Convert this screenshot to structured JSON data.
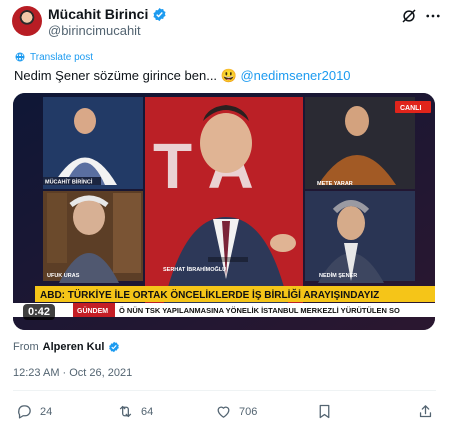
{
  "author": {
    "display_name": "Mücahit Birinci",
    "handle": "@birincimucahit"
  },
  "translate_label": "Translate post",
  "tweet": {
    "text": "Nedim Şener sözüme girince ben...",
    "emoji": "😃",
    "mention": "@nedimsener2010"
  },
  "video": {
    "duration": "0:42",
    "ticker_headline": "ABD: TÜRKİYE İLE ORTAK ÖNCELİKLERDE İŞ BİRLİĞİ ARAYIŞINDAYIZ",
    "ticker_section": "GÜNDEM",
    "ticker_text": "Ö NÜN TSK YAPILANMASINA YÖNELİK İSTANBUL MERKEZLİ YÜRÜTÜLEN SO",
    "live_badge": "CANLI",
    "channel_letters": "T  A",
    "panel_names": [
      "MÜCAHİT BİRİNCİ",
      "METE YARAR",
      "UFUK URAS",
      "SERHAT İBRAHİMOĞLU",
      "NEDİM ŞENER"
    ]
  },
  "attribution": {
    "prefix": "From",
    "source": "Alperen Kul"
  },
  "timestamp": "12:23 AM · Oct 26, 2021",
  "actions": {
    "replies": "24",
    "reposts": "64",
    "likes": "706"
  },
  "colors": {
    "accent": "#1d9bf0",
    "text": "#0f1419",
    "muted": "#536471",
    "live_red": "#e0241b",
    "ticker_yellow": "#f5c518"
  },
  "icons": [
    "grok-icon",
    "more-icon",
    "verified-icon",
    "translate-icon",
    "reply-icon",
    "repost-icon",
    "like-icon",
    "bookmark-icon",
    "share-icon"
  ]
}
